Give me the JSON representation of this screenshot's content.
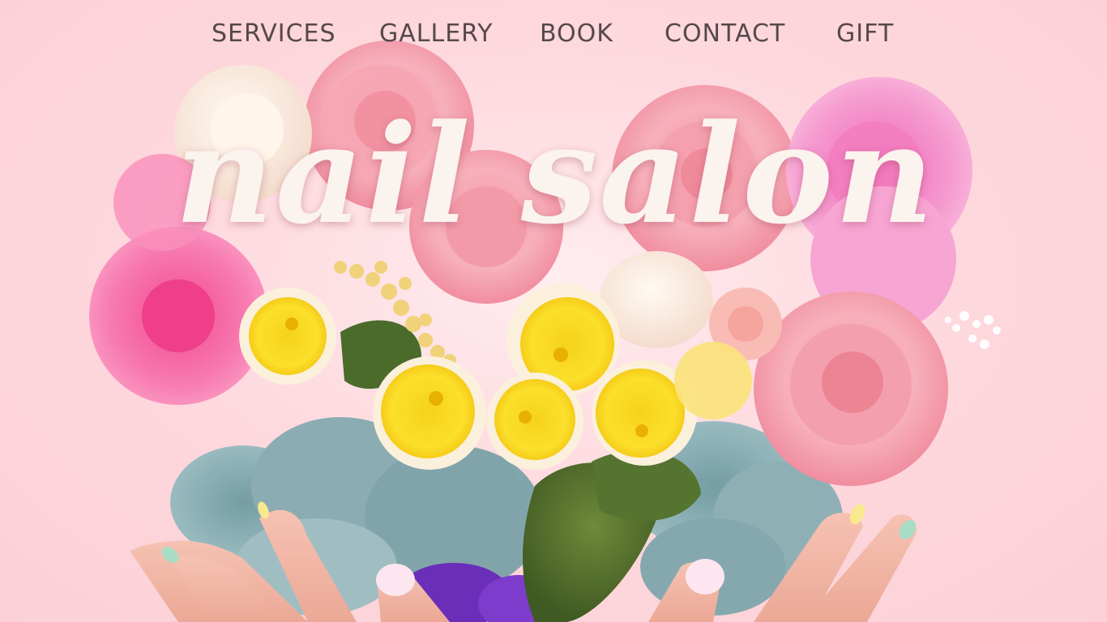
{
  "nav": {
    "items": [
      {
        "label": "SERVICES"
      },
      {
        "label": "GALLERY"
      },
      {
        "label": "BOOK"
      },
      {
        "label": "CONTACT"
      },
      {
        "label": "GIFT"
      }
    ]
  },
  "hero": {
    "title": "nail salon",
    "image": "flower-heart-bouquet-held-by-hands"
  },
  "colors": {
    "background": "#fdd7dc",
    "nav_text": "#56484b",
    "title_text": "#fbf3ee"
  }
}
